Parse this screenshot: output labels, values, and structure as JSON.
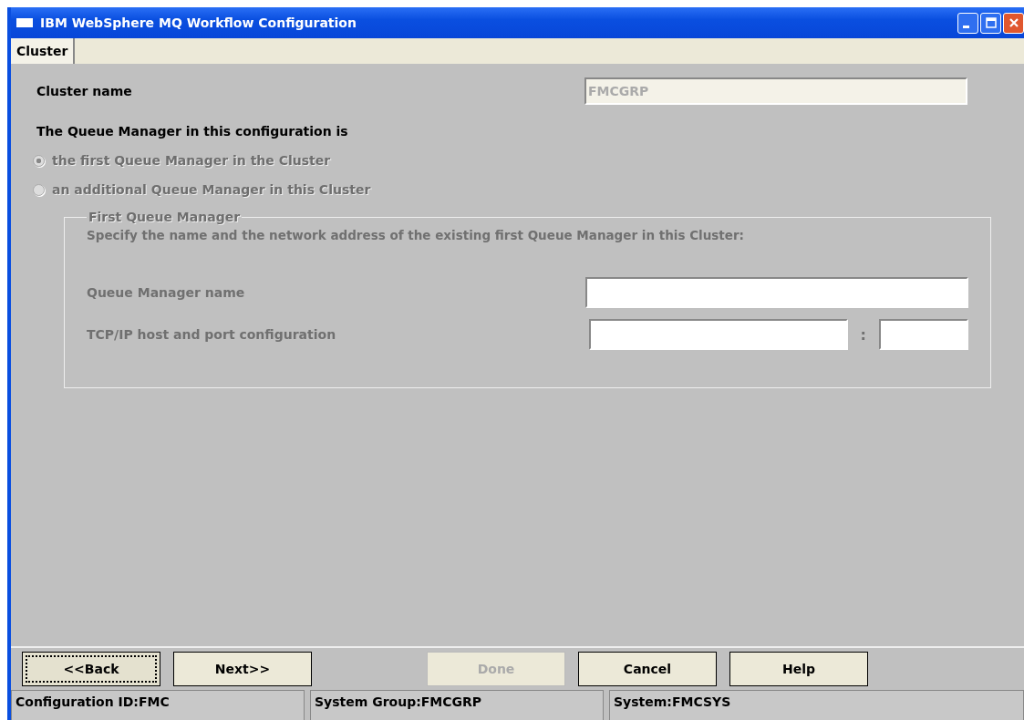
{
  "window": {
    "title": "IBM WebSphere MQ Workflow Configuration"
  },
  "tabs": [
    {
      "label": "Cluster",
      "selected": true
    }
  ],
  "cluster_name": {
    "label": "Cluster name",
    "value": "FMCGRP",
    "disabled": true
  },
  "queue_manager_prompt": "The Queue Manager in this configuration is",
  "options": [
    {
      "label": "the first Queue Manager in the Cluster",
      "selected": true,
      "disabled": true
    },
    {
      "label": "an additional Queue Manager in this Cluster",
      "selected": false,
      "disabled": true
    }
  ],
  "first_queue_manager": {
    "title": "First Queue Manager",
    "disabled": true,
    "description": "Specify the name and the network address of the existing first Queue Manager in this Cluster:",
    "name_label": "Queue Manager name",
    "host_label": "TCP/IP host and port configuration",
    "separator": ":"
  },
  "buttons": [
    {
      "label": "<<Back",
      "disabled": false,
      "focused": true
    },
    {
      "label": "Next>>",
      "disabled": false,
      "focused": false
    },
    {
      "label": "Done",
      "disabled": true,
      "focused": false
    },
    {
      "label": "Cancel",
      "disabled": false,
      "focused": false
    },
    {
      "label": "Help",
      "disabled": false,
      "focused": false
    }
  ],
  "status_bar": [
    "Configuration ID:FMC",
    "System Group:FMCGRP",
    "System:FMCSYS"
  ]
}
